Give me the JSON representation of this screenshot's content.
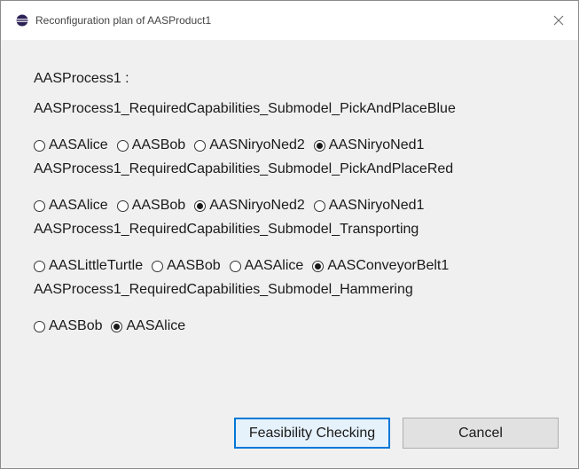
{
  "window": {
    "title": "Reconfiguration plan of AASProduct1",
    "close_glyph": "✕"
  },
  "process_label": "AASProcess1 :",
  "groups": [
    {
      "label": "AASProcess1_RequiredCapabilities_Submodel_PickAndPlaceBlue",
      "options": [
        {
          "label": "AASAlice",
          "checked": false
        },
        {
          "label": "AASBob",
          "checked": false
        },
        {
          "label": "AASNiryoNed2",
          "checked": false
        },
        {
          "label": "AASNiryoNed1",
          "checked": true
        }
      ]
    },
    {
      "label": "AASProcess1_RequiredCapabilities_Submodel_PickAndPlaceRed",
      "options": [
        {
          "label": "AASAlice",
          "checked": false
        },
        {
          "label": "AASBob",
          "checked": false
        },
        {
          "label": "AASNiryoNed2",
          "checked": true
        },
        {
          "label": "AASNiryoNed1",
          "checked": false
        }
      ]
    },
    {
      "label": "AASProcess1_RequiredCapabilities_Submodel_Transporting",
      "options": [
        {
          "label": "AASLittleTurtle",
          "checked": false
        },
        {
          "label": "AASBob",
          "checked": false
        },
        {
          "label": "AASAlice",
          "checked": false
        },
        {
          "label": "AASConveyorBelt1",
          "checked": true
        }
      ]
    },
    {
      "label": "AASProcess1_RequiredCapabilities_Submodel_Hammering",
      "options": [
        {
          "label": "AASBob",
          "checked": false
        },
        {
          "label": "AASAlice",
          "checked": true
        }
      ]
    }
  ],
  "buttons": {
    "feasibility": "Feasibility Checking",
    "cancel": "Cancel"
  }
}
